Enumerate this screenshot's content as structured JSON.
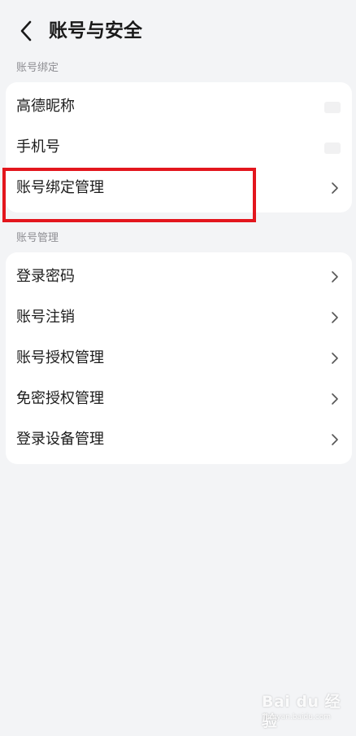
{
  "header": {
    "title": "账号与安全",
    "back_icon": "chevron-left-icon"
  },
  "sections": [
    {
      "label": "账号绑定",
      "items": [
        {
          "label": "高德昵称",
          "value_obscured": true
        },
        {
          "label": "手机号",
          "value_obscured": true
        },
        {
          "label": "账号绑定管理",
          "chevron_icon": "chevron-right-icon",
          "highlighted": true
        }
      ]
    },
    {
      "label": "账号管理",
      "items": [
        {
          "label": "登录密码",
          "chevron_icon": "chevron-right-icon"
        },
        {
          "label": "账号注销",
          "chevron_icon": "chevron-right-icon"
        },
        {
          "label": "账号授权管理",
          "chevron_icon": "chevron-right-icon"
        },
        {
          "label": "免密授权管理",
          "chevron_icon": "chevron-right-icon"
        },
        {
          "label": "登录设备管理",
          "chevron_icon": "chevron-right-icon"
        }
      ]
    }
  ],
  "annotation": {
    "highlight_color": "#e3161d"
  },
  "watermark": {
    "brand": "Bai du 经验",
    "url": "jingyan.baidu.com"
  },
  "colors": {
    "background": "#f3f4f6",
    "card": "#ffffff",
    "section_label": "#8e8e93",
    "text": "#1c1c1c"
  }
}
